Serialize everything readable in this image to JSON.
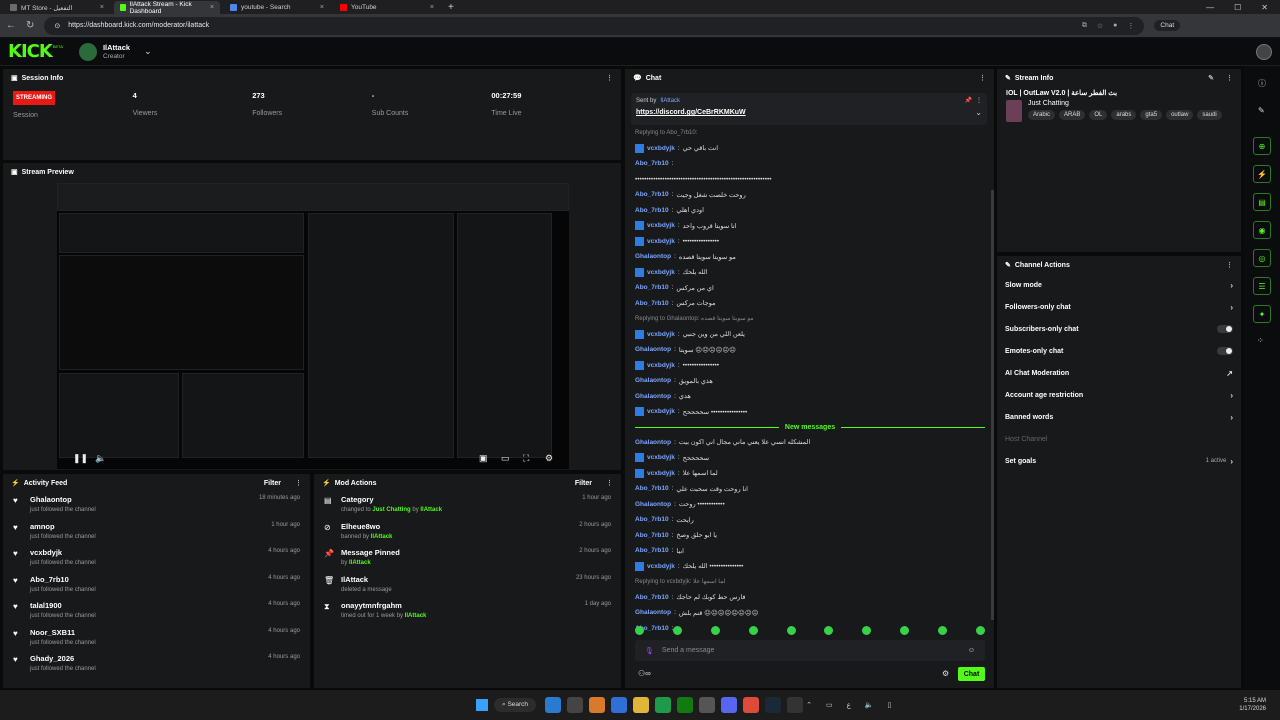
{
  "browser": {
    "tabs": [
      {
        "title": "MT Store - التفعيل",
        "color": "#6b6b6b",
        "active": false
      },
      {
        "title": "IlAttack Stream - Kick Dashboard",
        "color": "#53fc18",
        "active": true
      },
      {
        "title": "youtube - Search",
        "color": "#4f86ec",
        "active": false
      },
      {
        "title": "YouTube",
        "color": "#ff0000",
        "active": false
      }
    ],
    "url": "https://dashboard.kick.com/moderator/ilattack",
    "chat_label": "Chat"
  },
  "header": {
    "logo": "KICK",
    "beta": "BETA",
    "username": "IlAttack",
    "role": "Creator"
  },
  "session": {
    "title": "Session Info",
    "status": "STREAMING",
    "cells": [
      {
        "value": "",
        "label": "Session"
      },
      {
        "value": "4",
        "label": "Viewers"
      },
      {
        "value": "273",
        "label": "Followers"
      },
      {
        "value": "-",
        "label": "Sub Counts"
      },
      {
        "value": "00:27:59",
        "label": "Time Live"
      }
    ]
  },
  "preview": {
    "title": "Stream Preview"
  },
  "activity": {
    "title": "Activity Feed",
    "filter": "Filter",
    "items": [
      {
        "user": "Ghalaontop",
        "desc": "just followed the channel",
        "time": "18 minutes ago"
      },
      {
        "user": "amnop",
        "desc": "just followed the channel",
        "time": "1 hour ago"
      },
      {
        "user": "vcxbdyjk",
        "desc": "just followed the channel",
        "time": "4 hours ago"
      },
      {
        "user": "Abo_7rb10",
        "desc": "just followed the channel",
        "time": "4 hours ago"
      },
      {
        "user": "talal1900",
        "desc": "just followed the channel",
        "time": "4 hours ago"
      },
      {
        "user": "Noor_SXB11",
        "desc": "just followed the channel",
        "time": "4 hours ago"
      },
      {
        "user": "Ghady_2026",
        "desc": "just followed the channel",
        "time": "4 hours ago"
      }
    ]
  },
  "modactions": {
    "title": "Mod Actions",
    "filter": "Filter",
    "items": [
      {
        "title": "Category",
        "pre": "changed to ",
        "hl": "Just Chatting",
        "mid": " by ",
        "by": "IlAttack",
        "time": "1 hour ago",
        "icon": "category-icon"
      },
      {
        "title": "Elheue8wo",
        "pre": "banned by ",
        "hl": "",
        "mid": "",
        "by": "IlAttack",
        "time": "2 hours ago",
        "icon": "ban-icon"
      },
      {
        "title": "Message Pinned",
        "pre": "by ",
        "hl": "",
        "mid": "",
        "by": "IlAttack",
        "time": "2 hours ago",
        "icon": "pin-icon"
      },
      {
        "title": "IlAttack",
        "pre": "deleted a message",
        "hl": "",
        "mid": "",
        "by": "",
        "time": "23 hours ago",
        "icon": "trash-icon"
      },
      {
        "title": "onayytmnfrgahm",
        "pre": "timed out for 1 week by ",
        "hl": "",
        "mid": "",
        "by": "IlAttack",
        "time": "1 day ago",
        "icon": "hourglass-icon"
      }
    ]
  },
  "chat": {
    "title": "Chat",
    "pinned_by_label": "Sent by",
    "pinned_by": "IlAttack",
    "pinned_link": "https://discord.gg/CeBrRKMKuW",
    "new_messages": "New messages",
    "placeholder": "Send a message",
    "send": "Chat",
    "messages": [
      {
        "reply": "Replying to Abo_7rb10:",
        "user": "",
        "text": ""
      },
      {
        "user": "vcxbdyjk",
        "text": "انت باقي حي",
        "mod": true
      },
      {
        "user": "Abo_7rb10",
        "text": "",
        "mod": false
      },
      {
        "user": "",
        "text": "••••••••••••••••••••••••••••••••••••••••••••••••••••••••••••",
        "mod": false
      },
      {
        "user": "Abo_7rb10",
        "text": "روحت خلصت شغل وجيت",
        "mod": false
      },
      {
        "user": "Abo_7rb10",
        "text": "اودي اهلي",
        "mod": false
      },
      {
        "user": "vcxbdyjk",
        "text": "انا سويتا قروب واحد",
        "mod": true
      },
      {
        "user": "vcxbdyjk",
        "text": "••••••••••••••••",
        "mod": true
      },
      {
        "user": "Ghalaontop",
        "text": "مو سويتا سويتا قصده",
        "mod": false
      },
      {
        "user": "vcxbdyjk",
        "text": "الله يلحك",
        "mod": true
      },
      {
        "user": "Abo_7rb10",
        "text": "اي من مركس",
        "mod": false
      },
      {
        "user": "Abo_7rb10",
        "text": "موجات مركس",
        "mod": false
      },
      {
        "reply": "Replying to Ghalaontop: مو سويتا سويتا قصده",
        "user": "",
        "text": ""
      },
      {
        "user": "vcxbdyjk",
        "text": "يلعن اللي من وين جنبي",
        "mod": true
      },
      {
        "user": "Ghalaontop",
        "text": "سويتا ☹☹☹☹☹☹",
        "mod": false
      },
      {
        "user": "vcxbdyjk",
        "text": "••••••••••••••••",
        "mod": true
      },
      {
        "user": "Ghalaontop",
        "text": "هذي بالمويق",
        "mod": false
      },
      {
        "user": "Ghalaontop",
        "text": "هدي",
        "mod": false
      },
      {
        "user": "vcxbdyjk",
        "text": "سححححح ••••••••••••••••",
        "mod": true
      }
    ],
    "messages_after": [
      {
        "user": "Ghalaontop",
        "text": "المشكله انسي علا يعني ماني مجال اني اكون بيت",
        "mod": false
      },
      {
        "user": "vcxbdyjk",
        "text": "سححححح",
        "mod": true
      },
      {
        "user": "vcxbdyjk",
        "text": "لما اسمها علا",
        "mod": true
      },
      {
        "user": "Abo_7rb10",
        "text": "انا روحت وقت سحبت علي",
        "mod": false
      },
      {
        "user": "Ghalaontop",
        "text": "روحت ••••••••••••",
        "mod": false
      },
      {
        "user": "Abo_7rb10",
        "text": "رايحت",
        "mod": false
      },
      {
        "user": "Abo_7rb10",
        "text": "يا ابو حلق وصخ",
        "mod": false
      },
      {
        "user": "Abo_7rb10",
        "text": "ابيا",
        "mod": false
      },
      {
        "user": "vcxbdyjk",
        "text": "الله يلحك •••••••••••••••",
        "mod": true
      },
      {
        "reply": "Replying to vcxbdyjk: لما اسمها علا",
        "user": "",
        "text": ""
      },
      {
        "user": "Abo_7rb10",
        "text": "فارس حط كوبك لم حاجك",
        "mod": false
      },
      {
        "user": "Ghalaontop",
        "text": "قنم بلش ☹☹☹☹☹☹☹☹",
        "mod": false
      },
      {
        "user": "Abo_7rb10",
        "text": "",
        "mod": false
      }
    ]
  },
  "streaminfo": {
    "title": "Stream Info",
    "stream_title": "IOL | OutLaw V2.0 | بث الفطر ساعة",
    "category": "Just Chatting",
    "tags": [
      "Arabic",
      "ARAB",
      "OL",
      "arabs",
      "gta5",
      "outlaw",
      "saudi"
    ]
  },
  "channelactions": {
    "title": "Channel Actions",
    "rows": [
      {
        "label": "Slow mode",
        "ctrl": "arrow"
      },
      {
        "label": "Followers-only chat",
        "ctrl": "arrow"
      },
      {
        "label": "Subscribers-only chat",
        "ctrl": "toggle"
      },
      {
        "label": "Emotes-only chat",
        "ctrl": "toggle"
      },
      {
        "label": "AI Chat Moderation",
        "ctrl": "external"
      },
      {
        "label": "Account age restriction",
        "ctrl": "arrow"
      },
      {
        "label": "Banned words",
        "ctrl": "arrow"
      },
      {
        "label": "Host Channel",
        "ctrl": "none",
        "dim": true
      },
      {
        "label": "Set goals",
        "ctrl": "arrow",
        "extra": "1 active"
      }
    ]
  },
  "taskbar": {
    "search": "Search",
    "time": "5:15 AM",
    "date": "1/17/2026",
    "lang": "ع"
  }
}
